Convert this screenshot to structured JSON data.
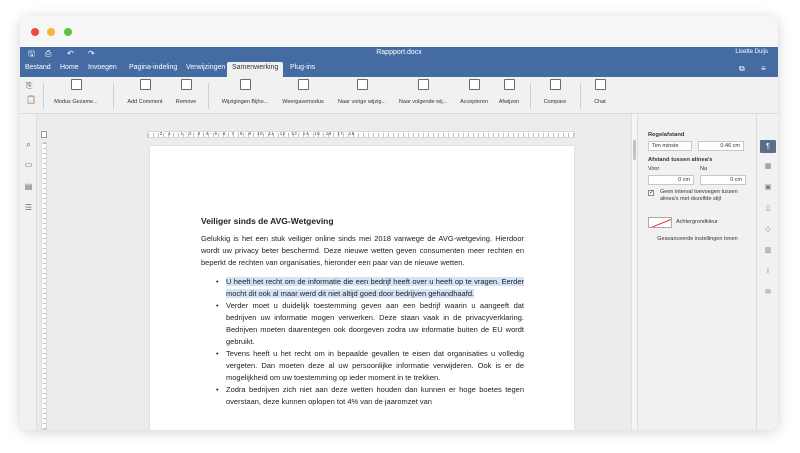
{
  "window": {
    "title": "Rappport.docx",
    "user": "Lisette Duijs",
    "quick_access": [
      "save-icon",
      "print-icon",
      "undo-icon",
      "redo-icon"
    ]
  },
  "tabs": [
    "Bestand",
    "Home",
    "Invoegen",
    "Pagina-indeling",
    "Verwijzingen",
    "Samenwerking",
    "Plug-ins"
  ],
  "active_tab": "Samenwerking",
  "ribbon": {
    "buttons": [
      {
        "label": "Modus Gezame..."
      },
      {
        "label": "Add Comment"
      },
      {
        "label": "Remove"
      },
      {
        "label": "Wijzigingen Bijho..."
      },
      {
        "label": "Weergavemodus"
      },
      {
        "label": "Naar vorige wijzig..."
      },
      {
        "label": "Naar volgende wij..."
      },
      {
        "label": "Accepteren"
      },
      {
        "label": "Afwijzen"
      },
      {
        "label": "Compare"
      },
      {
        "label": "Chat"
      }
    ]
  },
  "document": {
    "heading": "Veiliger sinds de AVG-Wetgeving",
    "intro": "Gelukkig is het een stuk veiliger online sinds mei 2018 vanwege de AVG-wetgeving. Hierdoor wordt uw privacy beter beschermd. Deze nieuwe wetten geven consumenten meer rechten en beperkt de rechten van organisaties, hieronder een paar van de nieuwe wetten.",
    "bullets": [
      "U heeft het recht om de informatie die een bedrijf heeft over u heeft op te vragen. Eerder mocht dit ook al maar werd dit niet altijd goed door bedrijven gehandhaafd.",
      "Verder moet u duidelijk toestemming geven aan een bedrijf waarin u aangeeft dat bedrijven uw informatie mogen verwerken. Deze staan vaak in de privacyverklaring. Bedrijven moeten daarentegen ook doorgeven zodra uw informatie buiten de EU wordt gebruikt.",
      "Tevens heeft u het recht om in bepaalde gevallen te eisen dat organisaties u volledig vergeten. Dan moeten deze al uw persoonlijke informatie verwijderen. Ook is er de mogelijkheid om uw toestemming op ieder moment in te trekken.",
      "Zodra bedrijven zich niet aan deze wetten houden dan kunnen er hoge boetes tegen overstaan, deze kunnen oplopen tot 4% van de jaaromzet van"
    ],
    "selected_bullet_index": 0
  },
  "right_panel": {
    "line_spacing_label": "Regelafstand",
    "line_spacing_mode": "Ten minste",
    "line_spacing_value": "0.46 cm",
    "paragraph_spacing_label": "Afstand tussen alinea's",
    "before_label": "Voor",
    "after_label": "Na",
    "before_value": "0 cm",
    "after_value": "0 cm",
    "checkbox_label_1": "Geen interval toevoegen tussen",
    "checkbox_label_2": "alinea's met dezelfde stijl",
    "checkbox_checked": true,
    "background_label": "Achtergrondkleur",
    "advanced_button": "Geavanceerde instellingen tonen"
  },
  "ruler": {
    "marks": "· 2 · 1 · · 1 · 2 · 3 · 4 · 5 · 6 · 7 · 8 · 9 · 10 · 11 · 12 · 13 · 14 · 15 · 16 · 17 · 18"
  },
  "colors": {
    "accent": "#446ca3",
    "selection": "#d4e3f6",
    "active_tool": "#5b6e88"
  }
}
